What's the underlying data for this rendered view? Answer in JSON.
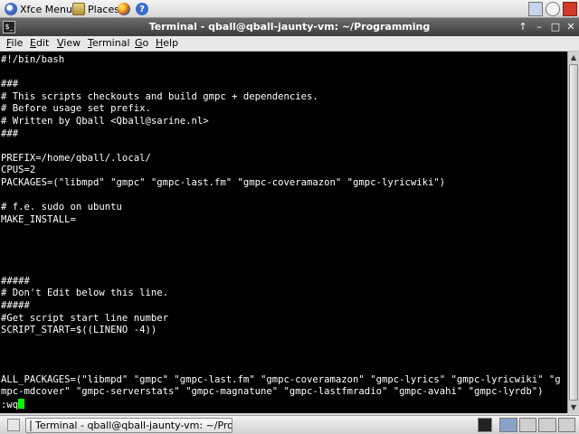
{
  "top_panel": {
    "xfce_menu_label": "Xfce Menu",
    "places_label": "Places"
  },
  "window": {
    "title": "Terminal - qball@qball-jaunty-vm: ~/Programming"
  },
  "menu": {
    "file": "File",
    "edit": "Edit",
    "view": "View",
    "terminal": "Terminal",
    "go": "Go",
    "help": "Help"
  },
  "terminal_lines": [
    "#!/bin/bash",
    "",
    "###",
    "# This scripts checkouts and build gmpc + dependencies.",
    "# Before usage set prefix.",
    "# Written by Qball <Qball@sarine.nl>",
    "###",
    "",
    "PREFIX=/home/qball/.local/",
    "CPUS=2",
    "PACKAGES=(\"libmpd\" \"gmpc\" \"gmpc-last.fm\" \"gmpc-coveramazon\" \"gmpc-lyricwiki\")",
    "",
    "# f.e. sudo on ubuntu",
    "MAKE_INSTALL=",
    "",
    "",
    "",
    "",
    "#####",
    "# Don't Edit below this line.",
    "#####",
    "#Get script start line number",
    "SCRIPT_START=$((LINENO -4))",
    "",
    "",
    "",
    "ALL_PACKAGES=(\"libmpd\" \"gmpc\" \"gmpc-last.fm\" \"gmpc-coveramazon\" \"gmpc-lyrics\" \"gmpc-lyricwiki\" \"g",
    "mpc-mdcover\" \"gmpc-serverstats\" \"gmpc-magnatune\" \"gmpc-lastfmradio\" \"gmpc-avahi\" \"gmpc-lyrdb\")",
    ":wq"
  ],
  "taskbar": {
    "task_label": "Terminal - qball@qball-jaunty-vm: ~/Pro..."
  },
  "colors": {
    "terminal_bg": "#000000",
    "terminal_fg": "#ffffff",
    "cursor": "#00ff00",
    "titlebar": "#4a4a4a"
  }
}
